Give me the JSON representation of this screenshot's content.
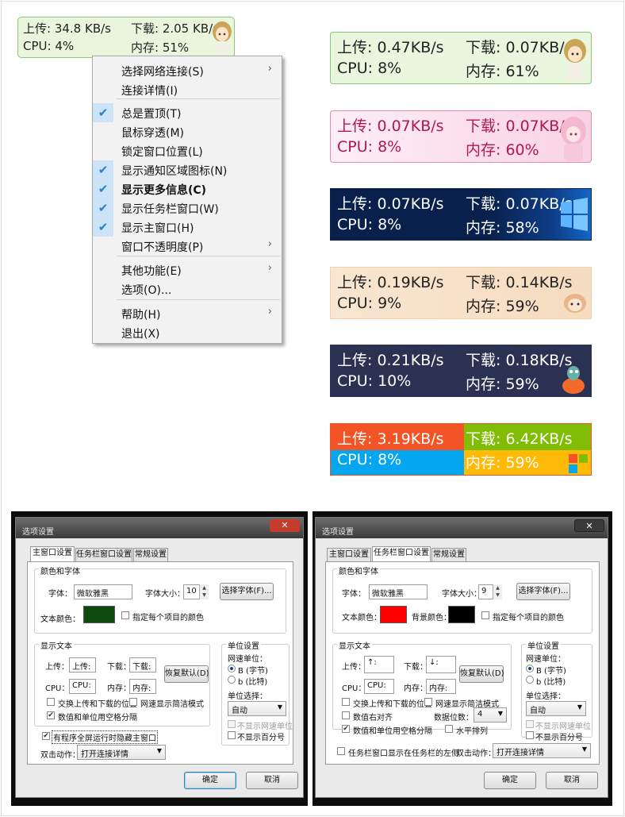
{
  "mini": {
    "up": "上传: 34.8 KB/s",
    "down": "下载: 2.05 KB/s",
    "cpu": "CPU: 4%",
    "mem": "内存: 51%"
  },
  "menu": {
    "items": [
      {
        "label": "选择网络连接(S)",
        "submenu": true,
        "checked": false
      },
      {
        "label": "连接详情(I)",
        "submenu": false,
        "checked": false
      },
      {
        "label": "总是置顶(T)",
        "submenu": false,
        "checked": true
      },
      {
        "label": "鼠标穿透(M)",
        "submenu": false,
        "checked": false
      },
      {
        "label": "锁定窗口位置(L)",
        "submenu": false,
        "checked": false
      },
      {
        "label": "显示通知区域图标(N)",
        "submenu": false,
        "checked": true
      },
      {
        "label": "显示更多信息(C)",
        "submenu": false,
        "checked": true
      },
      {
        "label": "显示任务栏窗口(W)",
        "submenu": false,
        "checked": true
      },
      {
        "label": "显示主窗口(H)",
        "submenu": false,
        "checked": true
      },
      {
        "label": "窗口不透明度(P)",
        "submenu": true,
        "checked": false
      },
      {
        "label": "其他功能(E)",
        "submenu": true,
        "checked": false
      },
      {
        "label": "选项(O)...",
        "submenu": false,
        "checked": false
      },
      {
        "label": "帮助(H)",
        "submenu": true,
        "checked": false
      },
      {
        "label": "退出(X)",
        "submenu": false,
        "checked": false
      }
    ],
    "arrow": "›",
    "check": "✔"
  },
  "skins": [
    {
      "up": "上传: 0.47KB/s",
      "down": "下载: 0.07KB/s",
      "cpu": "CPU: 8%",
      "mem": "内存: 61%",
      "bg": "#eaf7df",
      "border": "#8cc67a",
      "color": "#222222"
    },
    {
      "up": "上传: 0.07KB/s",
      "down": "下载: 0.07KB/s",
      "cpu": "CPU: 8%",
      "mem": "内存: 60%",
      "bg": "#fce4ef",
      "border": "#e08ab4",
      "color": "#b0184e"
    },
    {
      "up": "上传: 0.07KB/s",
      "down": "下载: 0.07KB/s",
      "cpu": "CPU: 8%",
      "mem": "内存: 58%",
      "bg": "#0b2350",
      "border": "#0b2350",
      "color": "#ffffff"
    },
    {
      "up": "上传: 0.19KB/s",
      "down": "下载: 0.14KB/s",
      "cpu": "CPU: 9%",
      "mem": "内存: 59%",
      "bg": "#f7e4cc",
      "border": "#f0d2b0",
      "color": "#222222"
    },
    {
      "up": "上传: 0.21KB/s",
      "down": "下载: 0.18KB/s",
      "cpu": "CPU: 10%",
      "mem": "内存: 59%",
      "bg": "#2c3350",
      "border": "#2c3350",
      "color": "#ffffff"
    },
    {
      "up": "上传: 3.19KB/s",
      "down": "下载: 6.42KB/s",
      "cpu": "CPU: 8%",
      "mem": "内存: 59%",
      "bg": "#f35325",
      "border": "#f35325",
      "color": "#ffffff"
    }
  ],
  "dialog": {
    "title": "选项设置",
    "close": "✕",
    "tabs": [
      "主窗口设置",
      "任务栏窗口设置",
      "常规设置"
    ],
    "color_font_group": "颜色和字体",
    "font_label": "字体：",
    "font_value": "微软雅黑",
    "size_label": "字体大小：",
    "size_main": "10",
    "size_taskbar": "9",
    "choose_font": "选择字体(F)...",
    "text_color": "文本颜色：",
    "bg_color": "背景颜色：",
    "per_item_color": "指定每个项目的颜色",
    "display_text_group": "显示文本",
    "up_label": "上传：",
    "down_label": "下载：",
    "cpu_label": "CPU：",
    "mem_label": "内存：",
    "main_up": "上传:",
    "main_down": "下载:",
    "main_cpu": "CPU:",
    "main_mem": "内存:",
    "tb_up": "↑:",
    "tb_down": "↓:",
    "tb_cpu": "CPU:",
    "tb_mem": "内存:",
    "restore_default": "恢复默认(D)",
    "swap_updown": "交换上传和下载的位置",
    "simple_speed": "网速显示简洁模式",
    "value_right": "数值右对齐",
    "space_unit": "数值和单位用空格分隔",
    "digits_label": "数据位数：",
    "digits_value": "4",
    "horizontal": "水平排列",
    "hide_fullscreen": "有程序全屏运行时隐藏主窗口",
    "taskbar_left": "任务栏窗口显示在任务栏的左侧",
    "dblclick_label": "双击动作：",
    "dblclick_value": "打开连接详情",
    "unit_group": "单位设置",
    "speed_unit": "网速单位：",
    "unit_byte": "B (字节)",
    "unit_bit": "b (比特)",
    "unit_select": "单位选择：",
    "unit_select_value": "自动",
    "hide_speed_unit": "不显示网速单位",
    "hide_percent": "不显示百分号",
    "ok": "确定",
    "cancel": "取消",
    "dropdown": "▼",
    "spin_up": "▲",
    "spin_down": "▼",
    "text_color_main": "#0d4a0d",
    "text_color_tb": "#ff0000",
    "bg_color_tb": "#000000"
  }
}
